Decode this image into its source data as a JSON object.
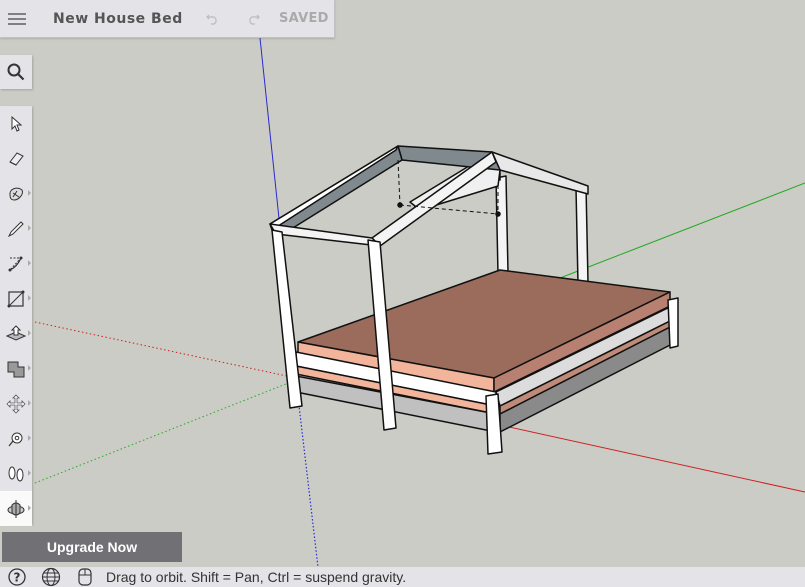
{
  "header": {
    "title": "New House Bed",
    "status": "SAVED",
    "icons": {
      "menu": "hamburger-icon",
      "undo": "undo-icon",
      "redo": "redo-icon"
    }
  },
  "search": {
    "icon": "search-icon"
  },
  "toolbar": {
    "tools": [
      {
        "name": "select",
        "icon": "arrow-cursor-icon",
        "has_submenu": false
      },
      {
        "name": "eraser",
        "icon": "eraser-icon",
        "has_submenu": false
      },
      {
        "name": "paint-bucket",
        "icon": "paint-icon",
        "has_submenu": true
      },
      {
        "name": "pencil",
        "icon": "pencil-icon",
        "has_submenu": true
      },
      {
        "name": "arc",
        "icon": "arc-icon",
        "has_submenu": true
      },
      {
        "name": "rectangle",
        "icon": "rectangle-icon",
        "has_submenu": true
      },
      {
        "name": "push-pull",
        "icon": "push-pull-icon",
        "has_submenu": true
      },
      {
        "name": "offset",
        "icon": "offset-icon",
        "has_submenu": true
      },
      {
        "name": "move",
        "icon": "move-icon",
        "has_submenu": true
      },
      {
        "name": "tape-measure",
        "icon": "tape-measure-icon",
        "has_submenu": true
      },
      {
        "name": "walk",
        "icon": "footprints-icon",
        "has_submenu": true
      },
      {
        "name": "orbit",
        "icon": "orbit-icon",
        "has_submenu": true,
        "active": true
      }
    ]
  },
  "upgrade_label": "Upgrade Now",
  "statusbar": {
    "text": "Drag to orbit. Shift = Pan, Ctrl = suspend gravity.",
    "icons": [
      "help-icon",
      "globe-icon",
      "mouse-icon"
    ]
  },
  "colors": {
    "background": "#ccccc6",
    "mattress_top": "#9b6b5c",
    "mattress_side": "#f2b59c",
    "frame": "#ffffff",
    "axis_red": "#cc2222",
    "axis_green": "#22aa22",
    "axis_blue": "#2222cc"
  }
}
